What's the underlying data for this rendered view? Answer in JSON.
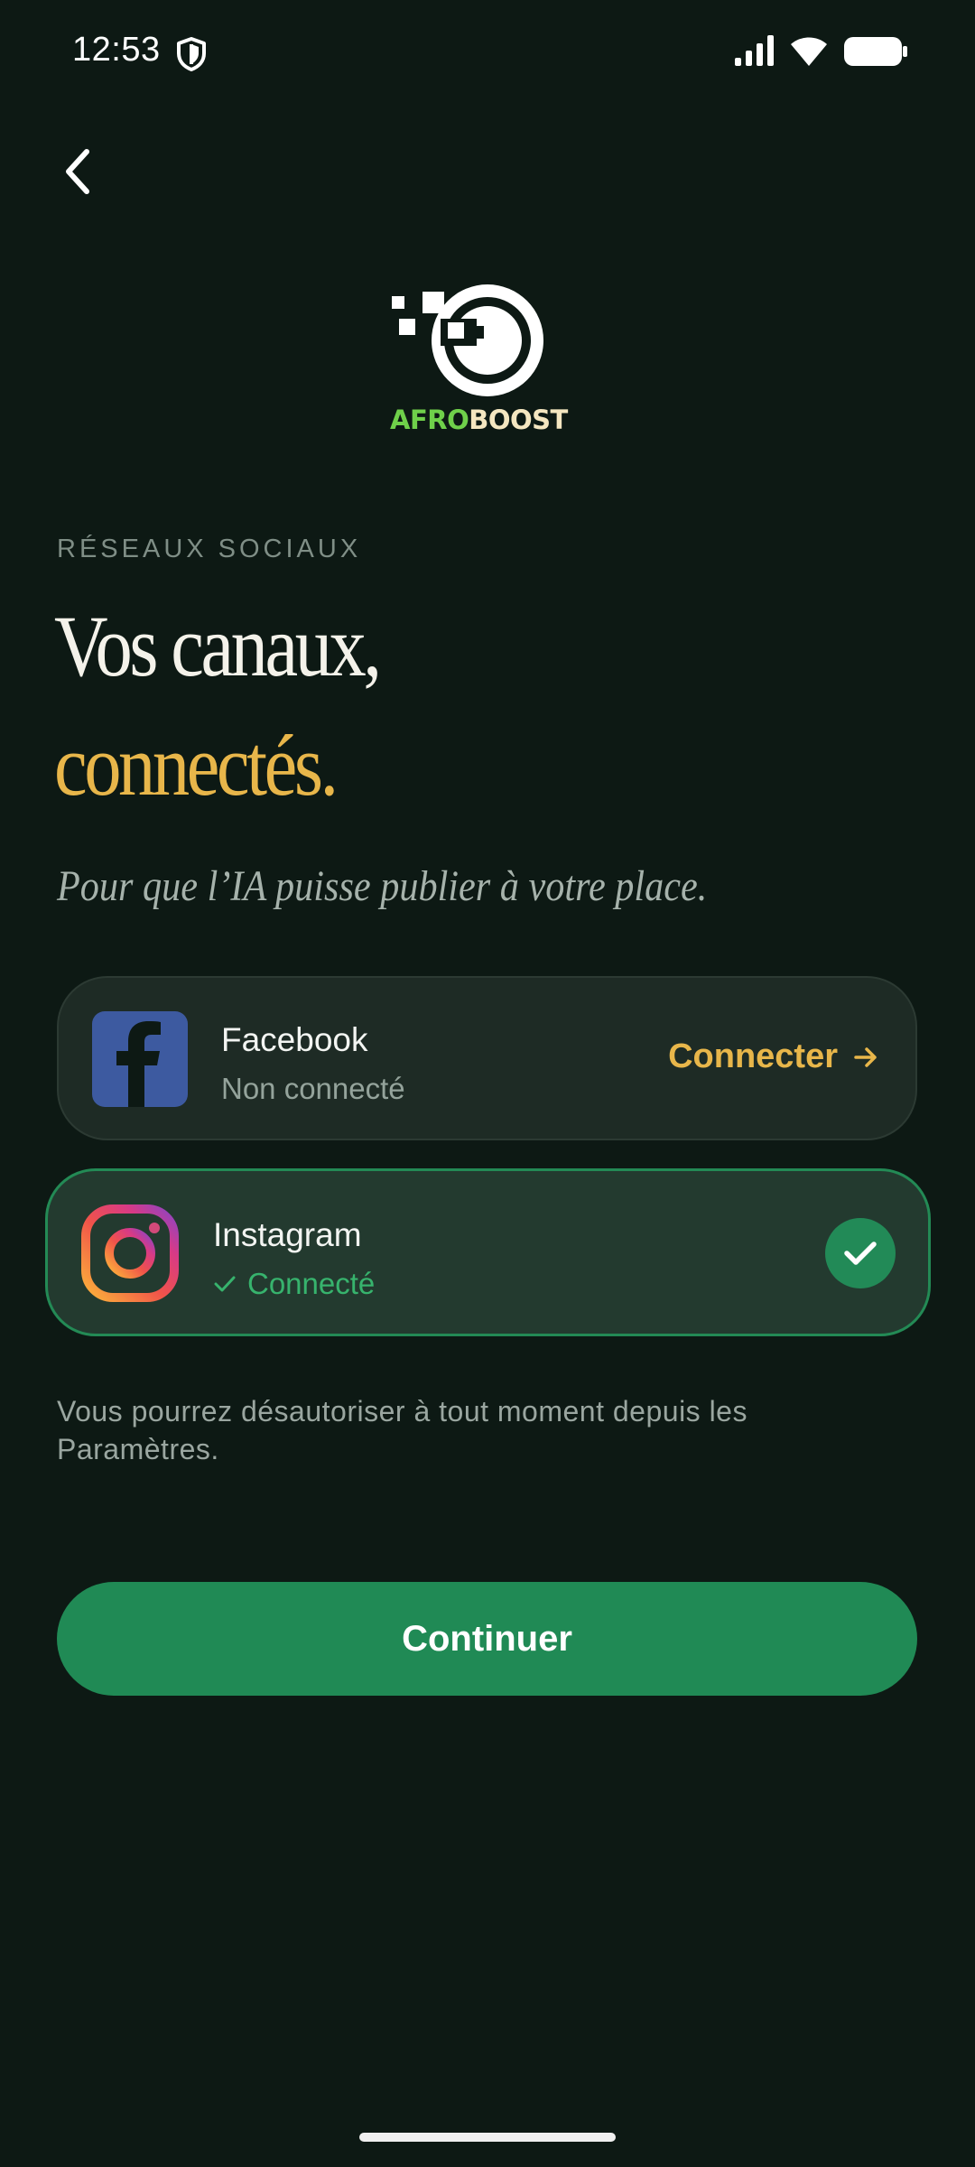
{
  "status_bar": {
    "time": "12:53",
    "icons": [
      "shield-icon",
      "signal-icon",
      "wifi-icon",
      "battery-icon"
    ]
  },
  "navigation": {
    "back_icon": "chevron-left-icon"
  },
  "logo": {
    "word_part_1": "AFRO",
    "word_part_2": "BOOST",
    "colors": {
      "afro": "#6fd04a",
      "boost": "#f4e6c0"
    }
  },
  "header": {
    "overline": "RÉSEAUX SOCIAUX",
    "title_line_1": "Vos canaux,",
    "title_line_2": "connectés.",
    "subtitle": "Pour que l’IA puisse publier à votre place."
  },
  "channels": [
    {
      "name": "Facebook",
      "status": "Non connecté",
      "action_label": "Connecter",
      "action_icon": "arrow-right-icon",
      "icon": "facebook-icon",
      "connected": false
    },
    {
      "name": "Instagram",
      "status": "Connecté",
      "status_icon": "check-icon",
      "icon": "instagram-icon",
      "connected": true,
      "badge_icon": "check-circle-icon"
    }
  ],
  "note": "Vous pourrez désautoriser à tout moment depuis les Paramètres.",
  "continue_label": "Continuer",
  "colors": {
    "background": "#0d1914",
    "accent_gold": "#e8b64a",
    "accent_green": "#208a55",
    "card": "#1e2b25"
  }
}
